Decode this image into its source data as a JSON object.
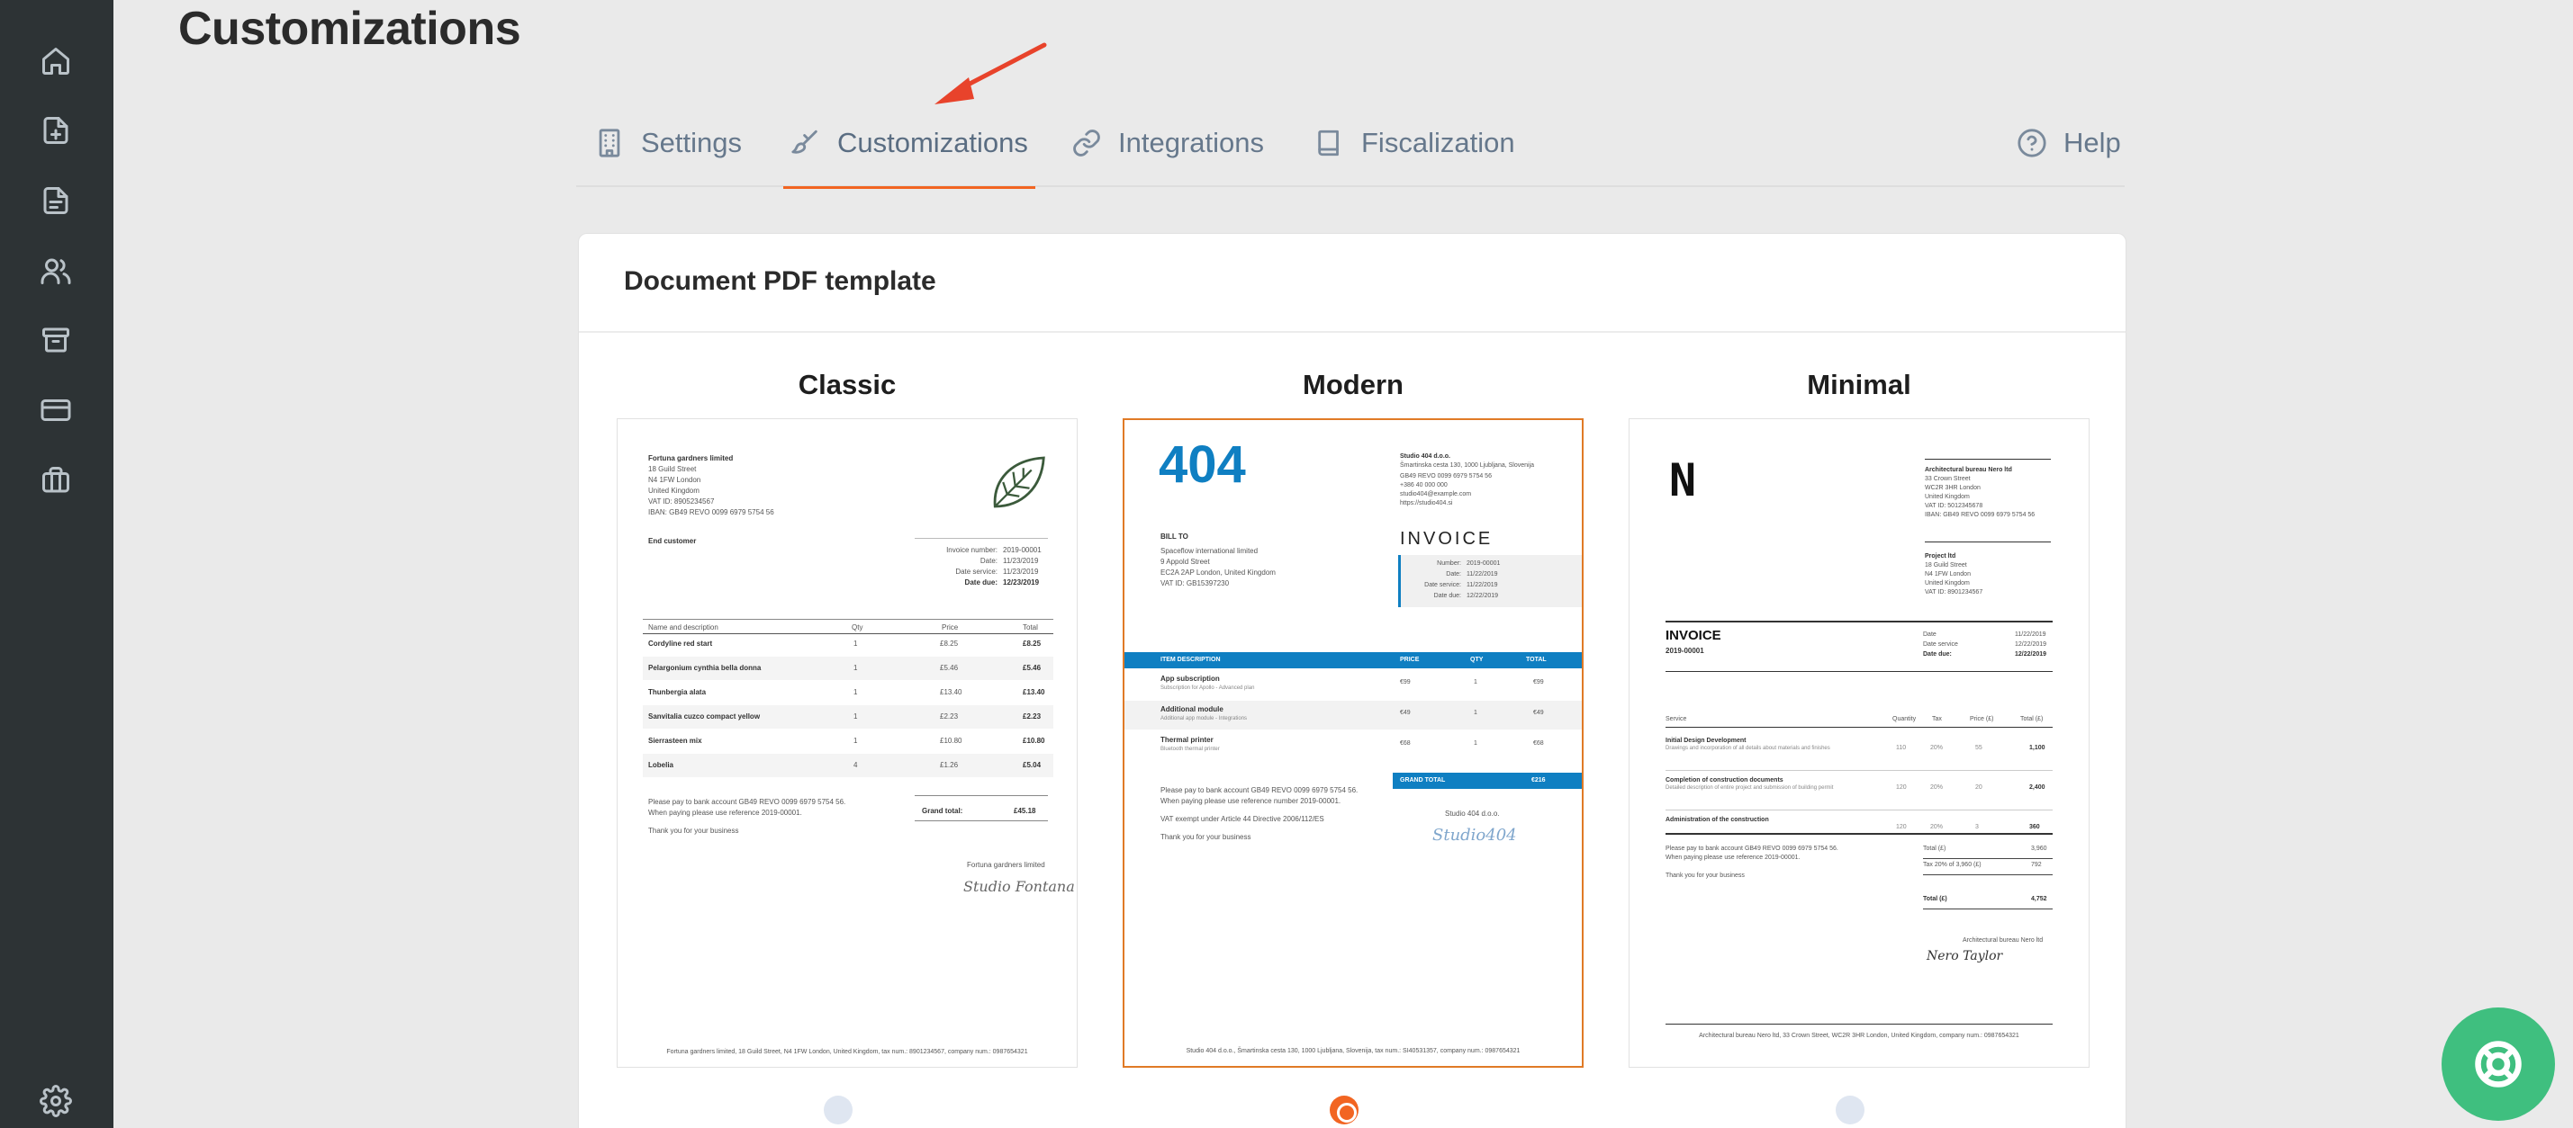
{
  "page": {
    "title": "Customizations"
  },
  "tabs": [
    {
      "label": "Settings"
    },
    {
      "label": "Customizations"
    },
    {
      "label": "Integrations"
    },
    {
      "label": "Fiscalization"
    }
  ],
  "help": {
    "label": "Help"
  },
  "card": {
    "title": "Document PDF template"
  },
  "accent_color": "#f26522",
  "templates": [
    {
      "name": "Classic",
      "selected": false,
      "company_lines": [
        "Fortuna gardners limited",
        "18 Guild Street",
        "N4 1FW London",
        "United Kingdom",
        "VAT ID: 8905234567",
        "IBAN: GB49 REVO 0099 6979 5754 56"
      ],
      "customer": "End customer",
      "meta": [
        [
          "Invoice number:",
          "2019-00001"
        ],
        [
          "Date:",
          "11/23/2019"
        ],
        [
          "Date service:",
          "11/23/2019"
        ],
        [
          "Date due:",
          "12/23/2019"
        ]
      ],
      "headers": [
        "Name and description",
        "Qty",
        "Price",
        "Total"
      ],
      "rows": [
        [
          "Cordyline red start",
          "1",
          "£8.25",
          "£8.25"
        ],
        [
          "Pelargonium cynthia bella donna",
          "1",
          "£5.46",
          "£5.46"
        ],
        [
          "Thunbergia alata",
          "1",
          "£13.40",
          "£13.40"
        ],
        [
          "Sanvitalia cuzco compact yellow",
          "1",
          "£2.23",
          "£2.23"
        ],
        [
          "Sierrasteen mix",
          "1",
          "£10.80",
          "£10.80"
        ],
        [
          "Lobelia",
          "4",
          "£1.26",
          "£5.04"
        ]
      ],
      "grand_total_label": "Grand total:",
      "grand_total": "£45.18",
      "notes": [
        "Please pay to bank account GB49 REVO 0099 6979 5754 56.",
        "When paying please use reference 2019-00001.",
        "Thank you for your business"
      ],
      "signer": "Fortuna gardners limited",
      "signature": "Studio Fontana",
      "footer": "Fortuna gardners limited, 18 Guild Street, N4 1FW London, United Kingdom, tax num.: 8901234567, company num.: 0987654321"
    },
    {
      "name": "Modern",
      "selected": true,
      "logo_text": "404",
      "company_lines": [
        "Studio 404 d.o.o.",
        "Šmartinska cesta 130, 1000 Ljubljana, Slovenija",
        "GB49 REVO 0099 6979 5754 56",
        "+386 40 000 000",
        "studio404@example.com",
        "https://studio404.si"
      ],
      "bill_to_label": "BILL TO",
      "bill_to_lines": [
        "Spaceflow international limited",
        "9 Appold Street",
        "EC2A 2AP London, United Kingdom",
        "VAT ID: GB15397230"
      ],
      "doc_title": "INVOICE",
      "meta": [
        [
          "Number:",
          "2019-00001"
        ],
        [
          "Date:",
          "11/22/2019"
        ],
        [
          "Date service:",
          "11/22/2019"
        ],
        [
          "Date due:",
          "12/22/2019"
        ]
      ],
      "headers": [
        "ITEM DESCRIPTION",
        "PRICE",
        "QTY",
        "TOTAL"
      ],
      "rows": [
        [
          "App subscription",
          "Subscription for Apollo - Advanced plan",
          "€99",
          "1",
          "€99"
        ],
        [
          "Additional module",
          "Additional app module - Integrations",
          "€49",
          "1",
          "€49"
        ],
        [
          "Thermal printer",
          "Bluetooth thermal printer",
          "€68",
          "1",
          "€68"
        ]
      ],
      "grand_total_label": "GRAND TOTAL",
      "grand_total": "€216",
      "notes": [
        "Please pay to bank account GB49 REVO 0099 6979 5754 56.",
        "When paying please use reference number 2019-00001.",
        "VAT exempt under Article 44 Directive 2006/112/ES",
        "Thank you for your business"
      ],
      "signer": "Studio 404 d.o.o.",
      "signature": "Studio404",
      "footer": "Studio 404 d.o.o., Šmartinska cesta 130, 1000 Ljubljana, Slovenija, tax num.: SI40531357, company num.: 0987654321",
      "brand_color": "#0f7fc2"
    },
    {
      "name": "Minimal",
      "selected": false,
      "logo_text": "N",
      "company_lines": [
        "Architectural bureau Nero ltd",
        "33 Crown Street",
        "WC2R 3HR London",
        "United Kingdom",
        "VAT ID: 5012345678",
        "IBAN: GB49 REVO 0099 6979 5754 56"
      ],
      "project_lines": [
        "Project ltd",
        "18 Guild Street",
        "N4 1FW London",
        "United Kingdom",
        "VAT ID: 8901234567"
      ],
      "doc_title": "INVOICE",
      "doc_number": "2019-00001",
      "meta": [
        [
          "Date",
          "11/22/2019"
        ],
        [
          "Date service",
          "12/22/2019"
        ],
        [
          "Date due:",
          "12/22/2019"
        ]
      ],
      "headers": [
        "Service",
        "Quantity",
        "Tax",
        "Price (£)",
        "Total (£)"
      ],
      "rows": [
        [
          "Initial Design Development",
          "Drawings and incorporation of all details about materials and finishes",
          "110",
          "20%",
          "55",
          "1,100"
        ],
        [
          "Completion of construction documents",
          "Detailed description of entire project and submission of building permit",
          "120",
          "20%",
          "20",
          "2,400"
        ],
        [
          "Administration of the construction",
          "",
          "120",
          "20%",
          "3",
          "360"
        ]
      ],
      "totals": [
        [
          "Total (£)",
          "3,960"
        ],
        [
          "Tax 20% of 3,960 (£)",
          "792"
        ],
        [
          "Total (£)",
          "4,752"
        ]
      ],
      "notes": [
        "Please pay to bank account GB49 REVO 0099 6979 5754 56.",
        "When paying please use reference 2019-00001.",
        "Thank you for your business"
      ],
      "signer": "Architectural bureau Nero ltd",
      "signature": "Nero Taylor",
      "footer": "Architectural bureau Nero ltd, 33 Crown Street, WC2R 3HR London, United Kingdom, company num.: 0987654321"
    }
  ]
}
